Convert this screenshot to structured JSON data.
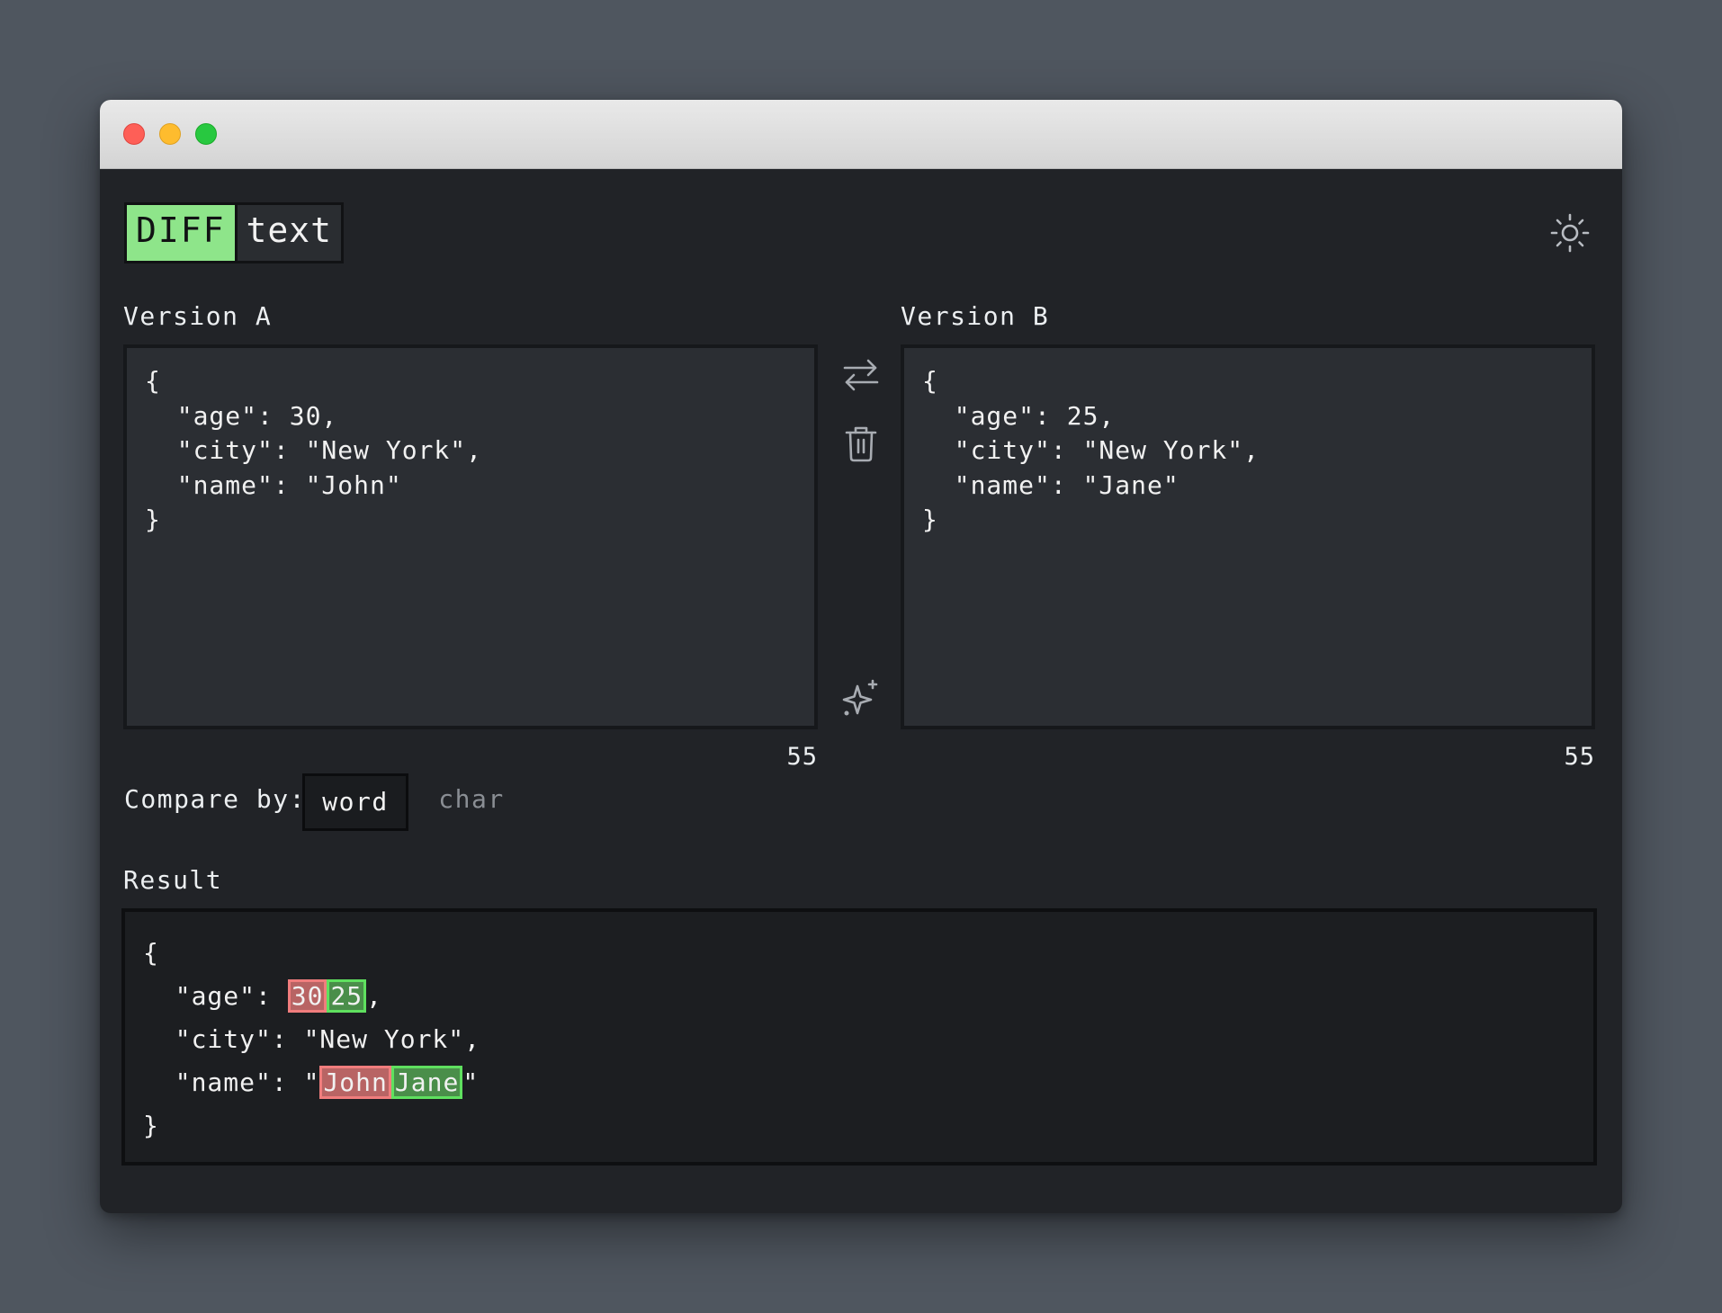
{
  "window": {
    "controls": [
      "close",
      "minimize",
      "zoom"
    ]
  },
  "logo": {
    "highlight": "DIFF",
    "text": "text"
  },
  "header": {
    "theme_icon": "sun-icon"
  },
  "version_a": {
    "label": "Version A",
    "content": "{\n  \"age\": 30,\n  \"city\": \"New York\",\n  \"name\": \"John\"\n}",
    "char_count": "55"
  },
  "version_b": {
    "label": "Version B",
    "content": "{\n  \"age\": 25,\n  \"city\": \"New York\",\n  \"name\": \"Jane\"\n}",
    "char_count": "55"
  },
  "tools": {
    "swap_icon": "swap-arrows-icon",
    "clear_icon": "trash-icon",
    "sample_icon": "sparkle-icon"
  },
  "compare": {
    "label": "Compare by:",
    "options": [
      "word",
      "char"
    ],
    "selected": "word"
  },
  "result": {
    "label": "Result",
    "lines": [
      [
        {
          "t": "{",
          "k": "same"
        }
      ],
      [
        {
          "t": "  \"age\": ",
          "k": "same"
        },
        {
          "t": "30",
          "k": "del"
        },
        {
          "t": "25",
          "k": "ins"
        },
        {
          "t": ",",
          "k": "same"
        }
      ],
      [
        {
          "t": "  \"city\": \"New York\",",
          "k": "same"
        }
      ],
      [
        {
          "t": "  \"name\": \"",
          "k": "same"
        },
        {
          "t": "John",
          "k": "del"
        },
        {
          "t": "Jane",
          "k": "ins"
        },
        {
          "t": "\"",
          "k": "same"
        }
      ],
      [
        {
          "t": "}",
          "k": "same"
        }
      ]
    ],
    "colors": {
      "removed_bg": "#b86464",
      "removed_border": "#f07d7d",
      "added_bg": "#4a8e4a",
      "added_border": "#5fe05f"
    }
  },
  "colors": {
    "accent": "#8ee58a",
    "background": "#212327",
    "desktop": "#4f565f"
  }
}
